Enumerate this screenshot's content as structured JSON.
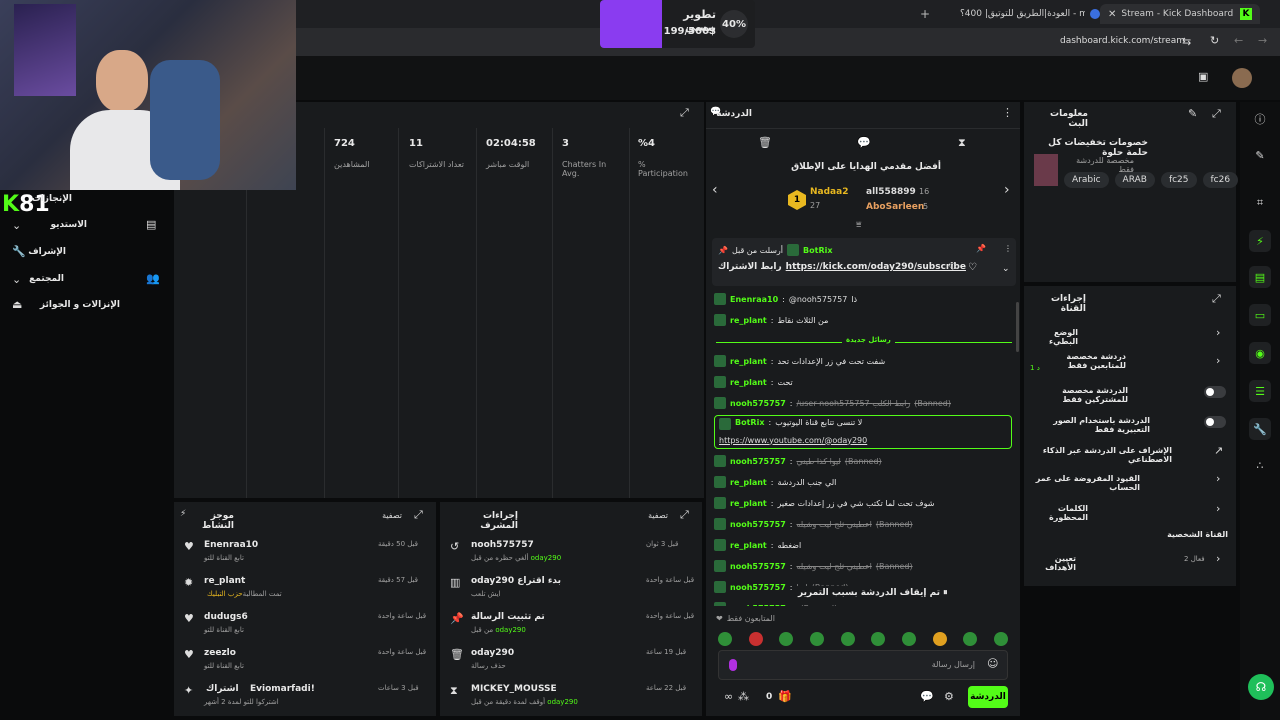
{
  "browser": {
    "tabs": [
      {
        "label": "Stream - Kick Dashboard",
        "active": true
      },
      {
        "label": "العودة|الطريق للتوتيق| 400؟ - m",
        "active": false
      }
    ],
    "url": "dashboard.kick.com/stream"
  },
  "goal": {
    "title": "تطوير بيسي",
    "amount": "199/500$",
    "percent": "40%"
  },
  "webcam_overlay": {
    "count": "81"
  },
  "sidebar": {
    "items": [
      {
        "label": "الإنجازات"
      },
      {
        "label": "الاستديو"
      },
      {
        "label": "الإشراف"
      },
      {
        "label": "المجتمع"
      },
      {
        "label": "الإنزالات و الجوائز"
      }
    ]
  },
  "stats": {
    "items": [
      {
        "value": "724",
        "label": "المشاهدين"
      },
      {
        "value": "11",
        "label": "تعداد الاشتراكات"
      },
      {
        "value": "02:04:58",
        "label": "الوقت مباشر"
      },
      {
        "value": "3",
        "label": "Chatters In Avg."
      },
      {
        "value": "%4",
        "label": "% Participation"
      }
    ]
  },
  "activity": {
    "title": "موجز النشاط",
    "filter": "تصفية",
    "items": [
      {
        "user": "Enenraa10",
        "desc": "تابع القناة للتو",
        "time": "قبل 50 دقيقة",
        "icon": "heart-icon"
      },
      {
        "user": "re_plant",
        "desc": "تمت المطالبة",
        "desc_highlight": "حزب التبليك",
        "time": "قبل 57 دقيقة",
        "icon": "sparkle-icon"
      },
      {
        "user": "dudugs6",
        "desc": "تابع القناة للتو",
        "time": "قبل ساعة واحدة",
        "icon": "heart-icon"
      },
      {
        "user": "zeezlo",
        "desc": "تابع القناة للتو",
        "time": "قبل ساعة واحدة",
        "icon": "heart-icon"
      },
      {
        "user": "Eviomarfadi!",
        "prefix": "اشتراك",
        "desc": "اشتركوا للتو لمدة 2 أشهر",
        "time": "قبل 3 ساعات",
        "icon": "star-icon"
      }
    ]
  },
  "modactions": {
    "title": "إجراءات المشرف",
    "filter": "تصفية",
    "items": [
      {
        "user": "nooh575757",
        "desc": "ألغي حظره من قبل",
        "by": "oday290",
        "time": "قبل 3 ثوان",
        "icon": "undo-icon"
      },
      {
        "user": "oday290",
        "suffix": "بدء اقتراع",
        "desc": "ايش تلعب",
        "time": "قبل ساعة واحدة",
        "icon": "poll-icon"
      },
      {
        "user": "تم تثبيت الرسالة",
        "desc": "من قبل",
        "by": "oday290",
        "time": "قبل ساعة واحدة",
        "icon": "pin-icon"
      },
      {
        "user": "oday290",
        "desc": "حذف رسالة",
        "time": "قبل 19 ساعة",
        "icon": "trash-icon"
      },
      {
        "user": "MICKEY_MOUSSE",
        "desc": "أوقف لمدة دقيقة من قبل",
        "by": "oday290",
        "time": "قبل 22 ساعة",
        "icon": "hourglass-icon"
      }
    ]
  },
  "chat": {
    "title": "الدردشة",
    "top_gifters_title": "أفضل مقدمي الهدايا على الإطلاق",
    "gifters": [
      {
        "name": "Nadaa2",
        "count": "27",
        "rank": "1"
      },
      {
        "name": "all558899",
        "count": "16"
      },
      {
        "name": "AboSarleen",
        "count": "5"
      }
    ],
    "pinned": {
      "label": "أرسلت من قبل",
      "user": "BotRix",
      "text_prefix": "رابط الاشتراك",
      "link": "https://kick.com/oday290/subscribe"
    },
    "new_messages_label": "رسائل جديدة",
    "messages": [
      {
        "user": "Enenraa10",
        "mention": "@nooh575757",
        "text": "ذا",
        "banned": false
      },
      {
        "user": "re_plant",
        "text": "من الثلاث نقاط",
        "banned": false
      },
      {
        "user": "re_plant",
        "text": "شفت تحت في زر الإعدادات تحد",
        "banned": false
      },
      {
        "user": "re_plant",
        "text": "تحت",
        "banned": false
      },
      {
        "user": "nooh575757",
        "text": "/user nooh575757 رابط الكلب",
        "banned": true,
        "banned_label": "(Banned)"
      },
      {
        "user": "BotRix",
        "text": "لا تنسى تتابع قناة اليوتيوب",
        "link": "https://www.youtube.com/@oday290",
        "highlight": true
      },
      {
        "user": "nooh575757",
        "text": "ليوا كذا طيني",
        "banned": true,
        "banned_label": "(Banned)"
      },
      {
        "user": "re_plant",
        "text": "الي جنب الدردشة",
        "banned": false
      },
      {
        "user": "re_plant",
        "text": "شوف تحت لما تكتب شي في زر إعدادات صغير",
        "banned": false
      },
      {
        "user": "nooh575757",
        "text": "اعطيني ثلج ليت وشيله",
        "banned": true,
        "banned_label": "(Banned)"
      },
      {
        "user": "re_plant",
        "text": "اضغطه",
        "banned": false
      },
      {
        "user": "nooh575757",
        "text": "اعطيني ثلج ليت وشيله",
        "banned": true,
        "banned_label": "(Banned)"
      },
      {
        "user": "nooh575757",
        "text": "ليوا",
        "banned": true,
        "banned_label": "(Banned)"
      },
      {
        "user": "nooh575757",
        "text": "",
        "banned": true,
        "banned_label": "(Banned)"
      }
    ],
    "paused_label": "تم إيقاف الدردشة بسبب التمرير",
    "followers_only": "المتابعون فقط",
    "input_placeholder": "إرسال رسالة",
    "send_label": "الدردشة",
    "points": "0"
  },
  "stream_info": {
    "title": "معلومات البث",
    "stream_title": "خصومات تخفيضات كل حلمة حلوة",
    "subtitle": "مخصصة للدردشة فقط",
    "tags": [
      "Arabic",
      "ARAB",
      "fc25",
      "fc26"
    ]
  },
  "channel_actions": {
    "title": "إجراءات القناة",
    "items": [
      {
        "label": "الوضع البطيء",
        "control": "chevron"
      },
      {
        "label": "دردشة مخصصة للمتابعين فقط",
        "sub": "1 د",
        "control": "chevron"
      },
      {
        "label": "الدردشة مخصصة للمشتركين فقط",
        "control": "toggle"
      },
      {
        "label": "الدردشة باستخدام الصور التعبيرية فقط",
        "control": "toggle"
      },
      {
        "label": "الإشراف على الدردشة عبر الذكاء الاصطناعي",
        "control": "external"
      },
      {
        "label": "القيود المفروضة على عمر الحساب",
        "control": "chevron"
      },
      {
        "label": "الكلمات المحظورة",
        "control": "chevron"
      }
    ],
    "personal_channel": "القناة الشخصية",
    "goals": {
      "label": "تعيين الأهداف",
      "status": "فعال 2"
    }
  }
}
